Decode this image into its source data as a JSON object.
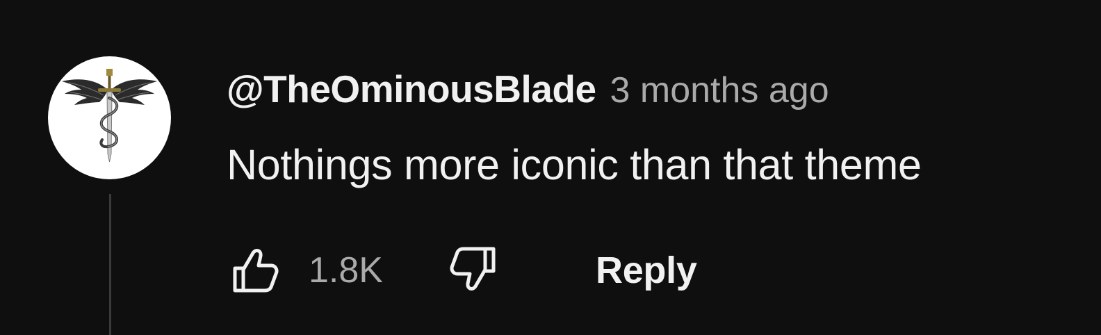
{
  "comment": {
    "author": "@TheOminousBlade",
    "timestamp": "3 months ago",
    "text": "Nothings more iconic than that theme",
    "like_count": "1.8K",
    "reply_label": "Reply"
  },
  "theme": {
    "background": "#0f0f0f",
    "primary_text": "#f1f1f1",
    "secondary_text": "#aaaaaa",
    "thread_line": "#3a3a3a"
  },
  "icons": {
    "avatar": "winged-sword-caduceus-logo",
    "like": "thumbs-up-icon",
    "dislike": "thumbs-down-icon"
  }
}
